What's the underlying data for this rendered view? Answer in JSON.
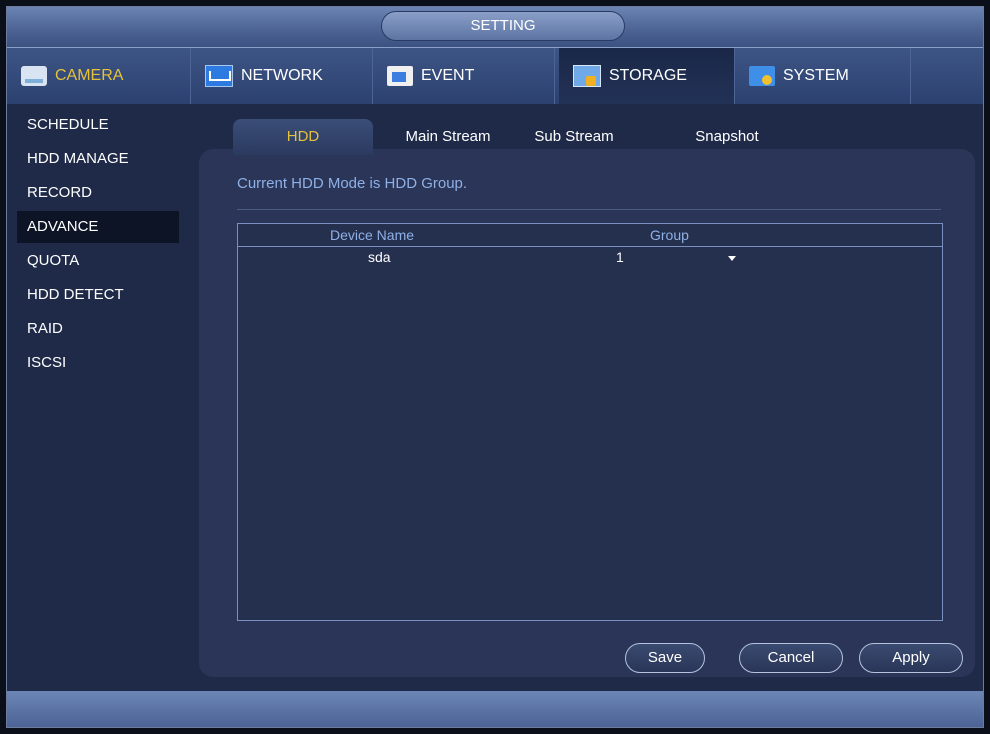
{
  "window": {
    "title": "SETTING"
  },
  "topnav": {
    "tabs": [
      {
        "label": "CAMERA",
        "icon": "camera-icon",
        "highlight": true
      },
      {
        "label": "NETWORK",
        "icon": "network-icon"
      },
      {
        "label": "EVENT",
        "icon": "event-icon"
      },
      {
        "label": "STORAGE",
        "icon": "storage-icon",
        "active": true
      },
      {
        "label": "SYSTEM",
        "icon": "system-icon"
      }
    ]
  },
  "sidebar": {
    "items": [
      {
        "label": "SCHEDULE"
      },
      {
        "label": "HDD MANAGE"
      },
      {
        "label": "RECORD"
      },
      {
        "label": "ADVANCE",
        "active": true
      },
      {
        "label": "QUOTA"
      },
      {
        "label": "HDD DETECT"
      },
      {
        "label": "RAID"
      },
      {
        "label": "ISCSI"
      }
    ]
  },
  "subtabs": [
    {
      "label": "HDD",
      "active": true
    },
    {
      "label": "Main Stream"
    },
    {
      "label": "Sub Stream"
    },
    {
      "label": "Snapshot"
    }
  ],
  "main": {
    "mode_text": "Current HDD Mode is HDD Group.",
    "table": {
      "headers": [
        "Device Name",
        "Group"
      ],
      "rows": [
        {
          "device": "sda",
          "group": "1"
        }
      ]
    }
  },
  "buttons": {
    "save": "Save",
    "cancel": "Cancel",
    "apply": "Apply"
  },
  "colors": {
    "accent": "#e5c23a",
    "info_text": "#8fb0e6",
    "panel": "#2a3557"
  }
}
